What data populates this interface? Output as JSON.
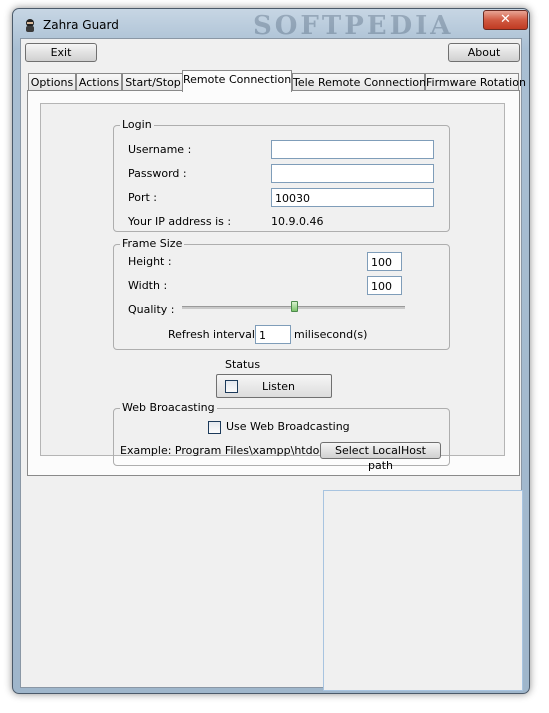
{
  "window": {
    "title": "Zahra Guard",
    "watermark": "SOFTPEDIA",
    "close_label": "✕"
  },
  "toolbar": {
    "exit_label": "Exit",
    "about_label": "About"
  },
  "tabs": [
    {
      "label": "Options",
      "active": false
    },
    {
      "label": "Actions",
      "active": false
    },
    {
      "label": "Start/Stop",
      "active": false
    },
    {
      "label": "Remote Connection",
      "active": true
    },
    {
      "label": "Tele Remote Connection",
      "active": false
    },
    {
      "label": "Firmware Rotation",
      "active": false
    }
  ],
  "login": {
    "legend": "Login",
    "username_label": "Username :",
    "username_value": "",
    "password_label": "Password :",
    "password_value": "",
    "port_label": "Port :",
    "port_value": "10030",
    "ip_label": "Your IP address is :",
    "ip_value": "10.9.0.46"
  },
  "frame": {
    "legend": "Frame Size",
    "height_label": "Height :",
    "height_value": "100",
    "width_label": "Width :",
    "width_value": "100",
    "quality_label": "Quality :",
    "quality_level": 0.5,
    "refresh_label": "Refresh interval :",
    "refresh_value": "1",
    "refresh_unit": "milisecond(s)"
  },
  "status": {
    "label": "Status",
    "listen_label": "Listen",
    "listen_checked": false
  },
  "web": {
    "legend": "Web Broacasting",
    "use_label": "Use Web Broadcasting",
    "use_checked": false,
    "example": "Example: Program Files\\xampp\\htdocs",
    "select_label": "Select LocalHost path"
  },
  "colors": {
    "accent": "#7f9db9",
    "close": "#c03a22",
    "preview_border": "#a8c4e0"
  }
}
